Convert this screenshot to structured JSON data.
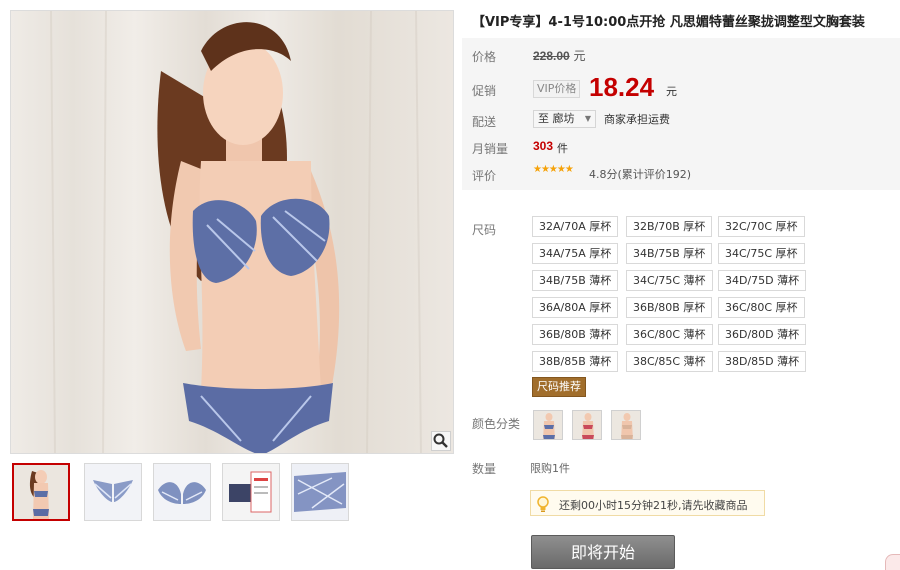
{
  "product": {
    "title": "【VIP专享】4-1号10:00点开抢 凡思媚特蕾丝聚拢调整型文胸套装"
  },
  "price": {
    "label": "价格",
    "original": "228.00",
    "original_unit": "元"
  },
  "promo": {
    "label": "促销",
    "tag": "VIP价格",
    "price": "18.24",
    "unit": "元"
  },
  "shipping": {
    "label": "配送",
    "destination": "至 廊坊",
    "note": "商家承担运费"
  },
  "sales": {
    "label": "月销量",
    "count": "303",
    "unit": "件"
  },
  "review": {
    "label": "评价",
    "stars": "★★★★★",
    "score_text": "4.8分(累计评价192)"
  },
  "sizes": {
    "label": "尺码",
    "rows": [
      [
        "32A/70A 厚杯",
        "32B/70B 厚杯",
        "32C/70C 厚杯"
      ],
      [
        "34A/75A 厚杯",
        "34B/75B 厚杯",
        "34C/75C 厚杯"
      ],
      [
        "34B/75B 薄杯",
        "34C/75C 薄杯",
        "34D/75D 薄杯"
      ],
      [
        "36A/80A 厚杯",
        "36B/80B 厚杯",
        "36C/80C 厚杯"
      ],
      [
        "36B/80B 薄杯",
        "36C/80C 薄杯",
        "36D/80D 薄杯"
      ],
      [
        "38B/85B 薄杯",
        "38C/85C 薄杯",
        "38D/85D 薄杯"
      ]
    ],
    "guide": "尺码推荐"
  },
  "colors": {
    "label": "颜色分类",
    "swatches": [
      "blue",
      "red",
      "nude"
    ]
  },
  "quantity": {
    "label": "数量",
    "limit": "限购1件"
  },
  "timer": {
    "icon": "lightbulb-icon",
    "text": "还剩00小时15分钟21秒,请先收藏商品"
  },
  "action": {
    "button": "即将开始"
  },
  "theme": {
    "accent": "#c40000",
    "button_gray": "#7a7a7a",
    "swatch_blue": "#5b6fa8",
    "swatch_red": "#c94a5a",
    "swatch_nude": "#d9b39a"
  }
}
